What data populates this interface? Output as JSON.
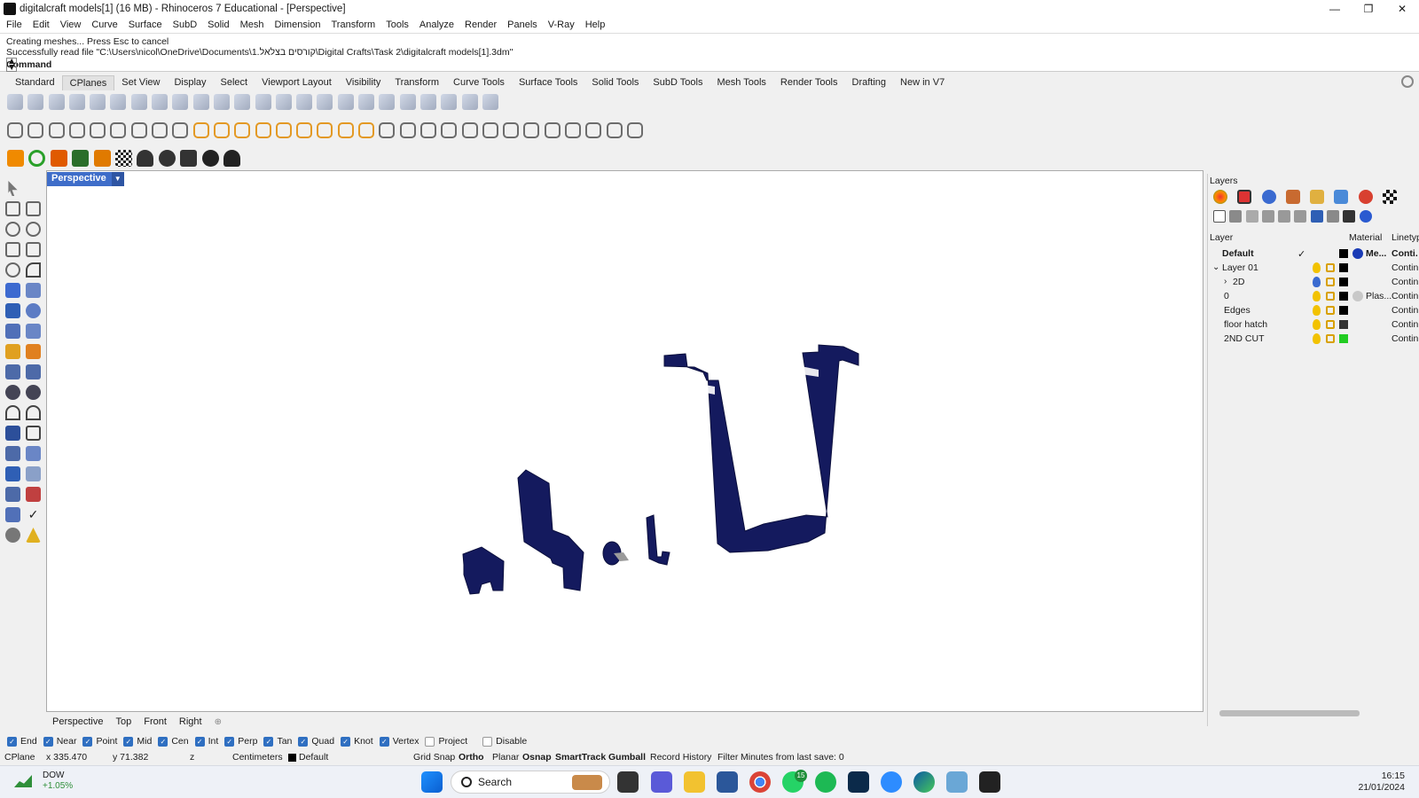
{
  "window": {
    "title": "digitalcraft models[1] (16 MB) - Rhinoceros 7 Educational - [Perspective]",
    "min": "—",
    "max": "❐",
    "close": "✕"
  },
  "menu": [
    "File",
    "Edit",
    "View",
    "Curve",
    "Surface",
    "SubD",
    "Solid",
    "Mesh",
    "Dimension",
    "Transform",
    "Tools",
    "Analyze",
    "Render",
    "Panels",
    "V-Ray",
    "Help"
  ],
  "command": {
    "line1": "Creating meshes... Press Esc to cancel",
    "line2": "Successfully read file \"C:\\Users\\nicol\\OneDrive\\Documents\\1.קורסים בצלאל\\Digital Crafts\\Task 2\\digitalcraft models[1].3dm\"",
    "prompt": "Command:"
  },
  "toolbar_tabs": [
    "Standard",
    "CPlanes",
    "Set View",
    "Display",
    "Select",
    "Viewport Layout",
    "Visibility",
    "Transform",
    "Curve Tools",
    "Surface Tools",
    "Solid Tools",
    "SubD Tools",
    "Mesh Tools",
    "Render Tools",
    "Drafting",
    "New in V7"
  ],
  "active_tab": "CPlanes",
  "viewport": {
    "label": "Perspective",
    "dropdown": "▼",
    "model_color": "#141a5e"
  },
  "viewport_tabs": [
    "Perspective",
    "Top",
    "Front",
    "Right"
  ],
  "viewport_add": "⊕",
  "layers_panel": {
    "title": "Layers",
    "headers": {
      "layer": "Layer",
      "material": "Material",
      "linetype": "Linetyp"
    },
    "rows": [
      {
        "name": "Default",
        "bold": true,
        "current": "✓",
        "color": "#000000",
        "material_color": "#1a3bb5",
        "material": "Me...",
        "linetype": "Conti.",
        "indent": 0,
        "expand": ""
      },
      {
        "name": "Layer 01",
        "bold": false,
        "current": "",
        "color": "#000000",
        "material_color": "",
        "material": "",
        "linetype": "Contin",
        "indent": 0,
        "expand": "⌄"
      },
      {
        "name": "2D",
        "bold": false,
        "current": "",
        "color": "#000000",
        "material_color": "",
        "material": "",
        "linetype": "Contin",
        "indent": 1,
        "expand": "›"
      },
      {
        "name": "0",
        "bold": false,
        "current": "",
        "color": "#000000",
        "material_color": "#c8c8c8",
        "material": "Plas...",
        "linetype": "Contin",
        "indent": 1,
        "expand": ""
      },
      {
        "name": "Edges",
        "bold": false,
        "current": "",
        "color": "#000000",
        "material_color": "",
        "material": "",
        "linetype": "Contin",
        "indent": 1,
        "expand": ""
      },
      {
        "name": "floor hatch",
        "bold": false,
        "current": "",
        "color": "#333333",
        "material_color": "",
        "material": "",
        "linetype": "Contin",
        "indent": 1,
        "expand": ""
      },
      {
        "name": "2ND CUT",
        "bold": false,
        "current": "",
        "color": "#22cc22",
        "material_color": "",
        "material": "",
        "linetype": "Contin",
        "indent": 1,
        "expand": ""
      }
    ]
  },
  "osnaps": [
    {
      "label": "End",
      "on": true
    },
    {
      "label": "Near",
      "on": true
    },
    {
      "label": "Point",
      "on": true
    },
    {
      "label": "Mid",
      "on": true
    },
    {
      "label": "Cen",
      "on": true
    },
    {
      "label": "Int",
      "on": true
    },
    {
      "label": "Perp",
      "on": true
    },
    {
      "label": "Tan",
      "on": true
    },
    {
      "label": "Quad",
      "on": true
    },
    {
      "label": "Knot",
      "on": true
    },
    {
      "label": "Vertex",
      "on": true
    },
    {
      "label": "Project",
      "on": false
    },
    {
      "label": "Disable",
      "on": false
    }
  ],
  "status": {
    "cplane": "CPlane",
    "x": "x 335.470",
    "y": "y 71.382",
    "z": "z",
    "units": "Centimeters",
    "layer": "Default",
    "grid_snap": "Grid Snap",
    "ortho": "Ortho",
    "planar": "Planar",
    "osnap": "Osnap",
    "smarttrack": "SmartTrack",
    "gumball": "Gumball",
    "record_history": "Record History",
    "filter": "Filter",
    "save_info": "Minutes from last save: 0"
  },
  "taskbar": {
    "weather_title": "DOW",
    "weather_change": "+1.05%",
    "search": "Search",
    "whatsapp_badge": "15",
    "time": "16:15",
    "date": "21/01/2024"
  }
}
